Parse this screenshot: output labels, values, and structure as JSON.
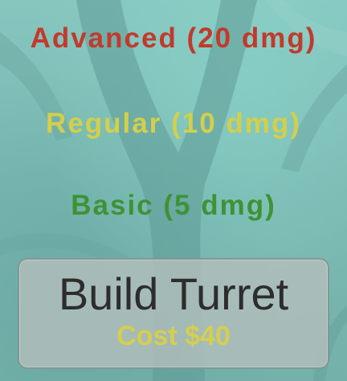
{
  "colors": {
    "background": "#7dbdb6",
    "advanced": "#c23a2c",
    "regular": "#d4cf4a",
    "basic": "#3f9235",
    "button_bg": "#b2bebc",
    "button_title": "#2d2d2d",
    "cost": "#d6cf4d"
  },
  "turret_options": {
    "advanced": "Advanced (20 dmg)",
    "regular": "Regular (10 dmg)",
    "basic": "Basic (5 dmg)"
  },
  "build_button": {
    "title": "Build Turret",
    "cost": "Cost $40"
  }
}
